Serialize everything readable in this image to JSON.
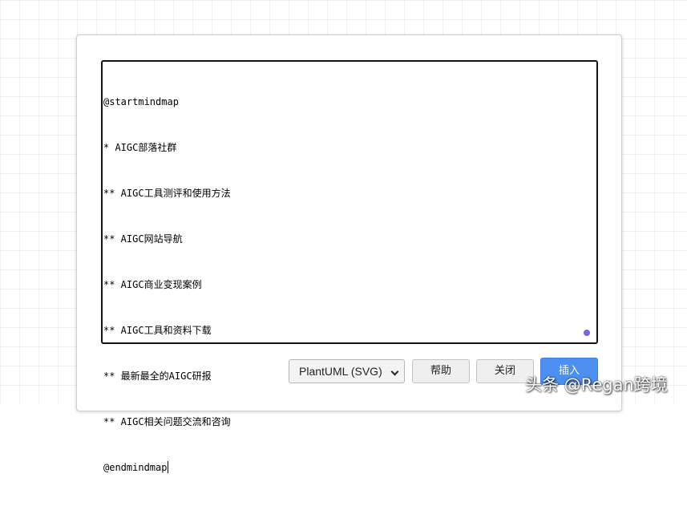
{
  "editor": {
    "lines": [
      "@startmindmap",
      "* AIGC部落社群",
      "** AIGC工具测评和使用方法",
      "** AIGC网站导航",
      "** AIGC商业变现案例",
      "** AIGC工具和资料下载",
      "** 最新最全的AIGC研报",
      "** AIGC相关问题交流和咨询",
      "@endmindmap"
    ]
  },
  "footer": {
    "format_select_value": "PlantUML (SVG)",
    "help_label": "帮助",
    "close_label": "关闭",
    "insert_label": "插入"
  },
  "watermark": "头条 @Regan跨境",
  "colors": {
    "insert_button": "#4d8ff0",
    "status_dot": "#7b63e6",
    "editor_border": "#111111"
  },
  "icons": {
    "select_arrow": "chevron-down-icon"
  }
}
